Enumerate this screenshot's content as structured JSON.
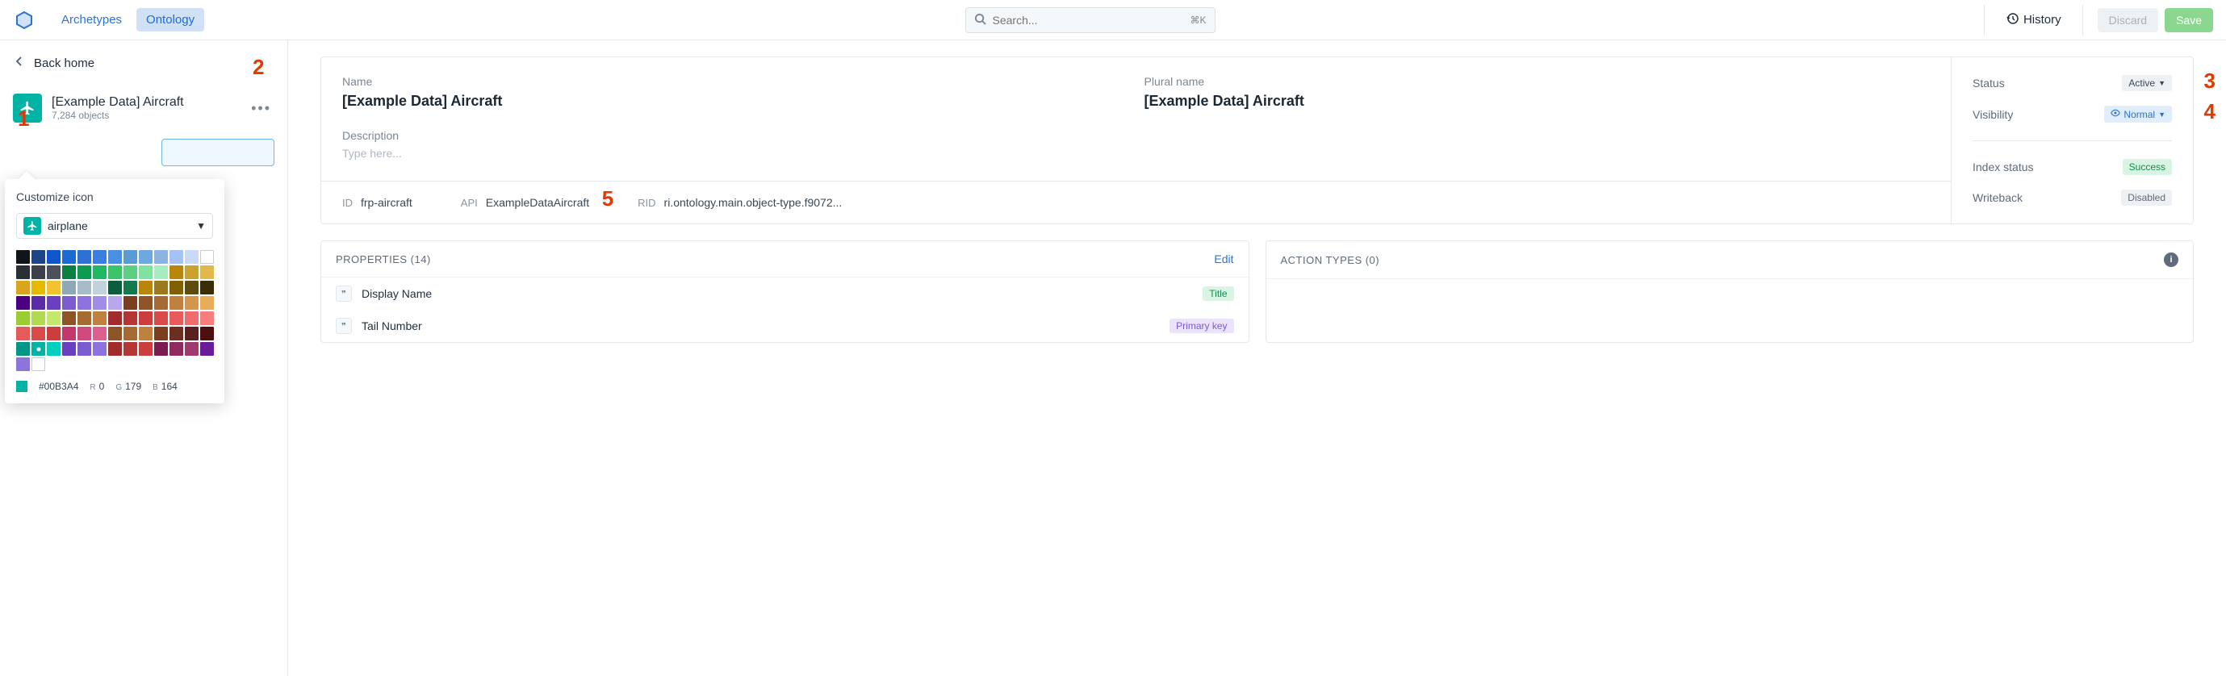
{
  "topbar": {
    "tabs": {
      "archetypes": "Archetypes",
      "ontology": "Ontology"
    },
    "search_placeholder": "Search...",
    "search_kbd": "⌘K",
    "history": "History",
    "discard": "Discard",
    "save": "Save"
  },
  "sidebar": {
    "back": "Back home",
    "entity_name": "[Example Data] Aircraft",
    "entity_sub": "7,284 objects"
  },
  "popover": {
    "title": "Customize icon",
    "icon_name": "airplane",
    "hex": "#00B3A4",
    "r_label": "R",
    "r": "0",
    "g_label": "G",
    "g": "179",
    "b_label": "B",
    "b": "164",
    "selected_color": "#00b3a4",
    "swatches": [
      "#111418",
      "#1c4587",
      "#1155cc",
      "#1b6bd1",
      "#2d72d2",
      "#3a7ee0",
      "#4a90e2",
      "#5b9bd5",
      "#6fa8dc",
      "#8db3e2",
      "#a4c2f4",
      "#c9daf8",
      "#ffffff",
      "#2b2f36",
      "#3b4049",
      "#4a505c",
      "#0b8043",
      "#0d9a53",
      "#1dba63",
      "#3ac569",
      "#5bd080",
      "#7fe29f",
      "#a7ebc0",
      "#b8860b",
      "#cca22e",
      "#e0b84c",
      "#d9a521",
      "#e6b800",
      "#f1c232",
      "#8fa8b7",
      "#a7bcc9",
      "#c0d2dc",
      "#0b5d3b",
      "#137a4e",
      "#b8860b",
      "#9c7a1c",
      "#806000",
      "#5f4b0b",
      "#3b2e07",
      "#4b0082",
      "#5a2aa8",
      "#6b3fc2",
      "#7c5bd1",
      "#8d73dd",
      "#a18ce6",
      "#b7a8ee",
      "#7b3f1f",
      "#8f5328",
      "#a66a33",
      "#bf8040",
      "#d4964d",
      "#e8ad5b",
      "#9acd32",
      "#b0da4f",
      "#c6e76d",
      "#8f5328",
      "#a66a33",
      "#bf8040",
      "#a02c2c",
      "#b63535",
      "#cc3e3e",
      "#d94a4a",
      "#e65a5a",
      "#f06b6b",
      "#fa7d7d",
      "#e65a5a",
      "#d94a4a",
      "#cc3e3e",
      "#c4366e",
      "#d14a7e",
      "#de5e8f",
      "#8f5328",
      "#a66a33",
      "#bf8040",
      "#7b3f1f",
      "#6b2f1f",
      "#5b1f1f",
      "#4b0f0f",
      "#009688",
      "#00b3a4",
      "#00cfc0",
      "#6b3fc2",
      "#7c5bd1",
      "#8d73dd",
      "#a02c2c",
      "#b63535",
      "#cc3e3e",
      "#7b1c50",
      "#8d2a60",
      "#9f3970",
      "#6a1b9a",
      "#8d73dd",
      "#ffffff"
    ]
  },
  "details": {
    "name_label": "Name",
    "name_value": "[Example Data] Aircraft",
    "plural_label": "Plural name",
    "plural_value": "[Example Data] Aircraft",
    "desc_label": "Description",
    "desc_placeholder": "Type here...",
    "status_label": "Status",
    "status_value": "Active",
    "visibility_label": "Visibility",
    "visibility_value": "Normal",
    "index_label": "Index status",
    "index_value": "Success",
    "writeback_label": "Writeback",
    "writeback_value": "Disabled",
    "id_label": "ID",
    "id_value": "frp-aircraft",
    "api_label": "API",
    "api_value": "ExampleDataAircraft",
    "rid_label": "RID",
    "rid_value": "ri.ontology.main.object-type.f9072..."
  },
  "properties": {
    "header": "PROPERTIES (14)",
    "edit": "Edit",
    "items": [
      {
        "name": "Display Name",
        "tag": "Title",
        "tag_class": "tag-title"
      },
      {
        "name": "Tail Number",
        "tag": "Primary key",
        "tag_class": "tag-pk"
      }
    ]
  },
  "action_types": {
    "header": "ACTION TYPES (0)"
  },
  "annotations": {
    "a1": "1",
    "a2": "2",
    "a3": "3",
    "a4": "4",
    "a5": "5"
  }
}
